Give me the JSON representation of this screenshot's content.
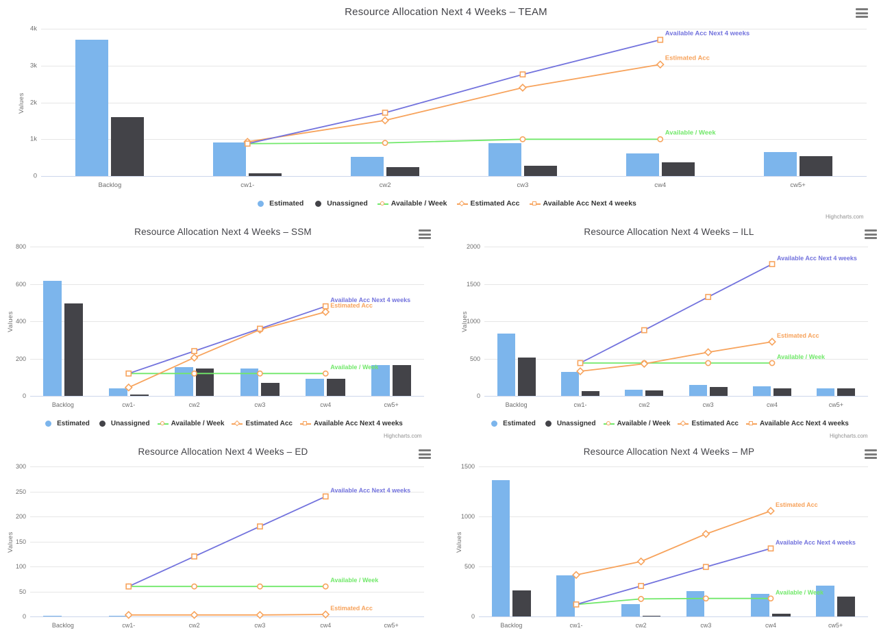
{
  "colors": {
    "estimated": "#7cb5ec",
    "unassigned": "#434348",
    "available_week": "#71e86a",
    "estimated_acc": "#f7a35c",
    "available_acc": "#7272dd",
    "marker_outline": "#f7a35c",
    "gridline": "#e6e6e6",
    "axis": "#ccd6eb",
    "text": "#6e6e6e"
  },
  "common": {
    "menu_icon": "hamburger-menu-icon",
    "credit": "Highcharts.com",
    "ylabel": "Values",
    "legend": [
      {
        "label": "Estimated",
        "symbol": "circle-filled",
        "color": "#7cb5ec"
      },
      {
        "label": "Unassigned",
        "symbol": "circle-filled",
        "color": "#434348"
      },
      {
        "label": "Available / Week",
        "symbol": "line-circle",
        "color": "#71e86a"
      },
      {
        "label": "Estimated Acc",
        "symbol": "line-diamond",
        "color": "#f7a35c"
      },
      {
        "label": "Available Acc Next 4 weeks",
        "symbol": "line-square",
        "color": "#f7a35c"
      }
    ]
  },
  "chart_data": [
    {
      "id": "team",
      "type": "bar",
      "title": "Resource Allocation Next 4 Weeks – TEAM",
      "xlabel": "",
      "ylabel": "Values",
      "categories": [
        "Backlog",
        "cw1-",
        "cw2",
        "cw3",
        "cw4",
        "cw5+"
      ],
      "ylim": [
        0,
        4000
      ],
      "yticks": [
        0,
        1000,
        2000,
        3000,
        4000
      ],
      "yticklabels": [
        "0",
        "1k",
        "2k",
        "3k",
        "4k"
      ],
      "grid": true,
      "legend_position": "bottom",
      "series": [
        {
          "name": "Estimated",
          "type": "column",
          "color": "#7cb5ec",
          "values": [
            3700,
            920,
            520,
            900,
            620,
            660
          ]
        },
        {
          "name": "Unassigned",
          "type": "column",
          "color": "#434348",
          "values": [
            1600,
            80,
            240,
            280,
            370,
            540
          ]
        },
        {
          "name": "Available / Week",
          "type": "line",
          "color": "#71e86a",
          "values": [
            null,
            880,
            900,
            1000,
            1000,
            null
          ],
          "label": "Available / Week",
          "label_at": 4
        },
        {
          "name": "Estimated Acc",
          "type": "line",
          "color": "#f7a35c",
          "values": [
            null,
            930,
            1510,
            2400,
            3030,
            null
          ],
          "label": "Estimated Acc",
          "label_at": 4
        },
        {
          "name": "Available Acc Next 4 weeks",
          "type": "line",
          "color": "#7272dd",
          "values": [
            null,
            880,
            1720,
            2760,
            3700,
            null
          ],
          "label": "Available Acc Next 4 weeks",
          "label_at": 4
        }
      ]
    },
    {
      "id": "ssm",
      "type": "bar",
      "title": "Resource Allocation Next 4 Weeks – SSM",
      "xlabel": "",
      "ylabel": "Values",
      "categories": [
        "Backlog",
        "cw1-",
        "cw2",
        "cw3",
        "cw4",
        "cw5+"
      ],
      "ylim": [
        0,
        800
      ],
      "yticks": [
        0,
        200,
        400,
        600,
        800
      ],
      "yticklabels": [
        "0",
        "200",
        "400",
        "600",
        "800"
      ],
      "grid": true,
      "legend_position": "bottom",
      "series": [
        {
          "name": "Estimated",
          "type": "column",
          "color": "#7cb5ec",
          "values": [
            615,
            42,
            153,
            148,
            90,
            165
          ]
        },
        {
          "name": "Unassigned",
          "type": "column",
          "color": "#434348",
          "values": [
            495,
            8,
            148,
            68,
            90,
            165
          ]
        },
        {
          "name": "Available / Week",
          "type": "line",
          "color": "#71e86a",
          "values": [
            null,
            120,
            120,
            120,
            120,
            null
          ],
          "label": "Available / Week",
          "label_at": 4
        },
        {
          "name": "Estimated Acc",
          "type": "line",
          "color": "#f7a35c",
          "values": [
            null,
            45,
            205,
            355,
            450,
            null
          ],
          "label": "Estimated Acc",
          "label_at": 4
        },
        {
          "name": "Available Acc Next 4 weeks",
          "type": "line",
          "color": "#7272dd",
          "values": [
            null,
            120,
            240,
            360,
            480,
            null
          ],
          "label": "Available Acc Next 4 weeks",
          "label_at": 4
        }
      ]
    },
    {
      "id": "ill",
      "type": "bar",
      "title": "Resource Allocation Next 4 Weeks – ILL",
      "xlabel": "",
      "ylabel": "Values",
      "categories": [
        "Backlog",
        "cw1-",
        "cw2",
        "cw3",
        "cw4",
        "cw5+"
      ],
      "ylim": [
        0,
        2000
      ],
      "yticks": [
        0,
        500,
        1000,
        1500,
        2000
      ],
      "yticklabels": [
        "0",
        "500",
        "1000",
        "1500",
        "2000"
      ],
      "grid": true,
      "legend_position": "bottom",
      "series": [
        {
          "name": "Estimated",
          "type": "column",
          "color": "#7cb5ec",
          "values": [
            835,
            320,
            85,
            145,
            130,
            100
          ]
        },
        {
          "name": "Unassigned",
          "type": "column",
          "color": "#434348",
          "values": [
            510,
            60,
            70,
            120,
            105,
            100
          ]
        },
        {
          "name": "Available / Week",
          "type": "line",
          "color": "#71e86a",
          "values": [
            null,
            440,
            440,
            440,
            440,
            null
          ],
          "label": "Available / Week",
          "label_at": 4
        },
        {
          "name": "Estimated Acc",
          "type": "line",
          "color": "#f7a35c",
          "values": [
            null,
            330,
            430,
            585,
            725,
            null
          ],
          "label": "Estimated Acc",
          "label_at": 4
        },
        {
          "name": "Available Acc Next 4 weeks",
          "type": "line",
          "color": "#7272dd",
          "values": [
            null,
            440,
            880,
            1325,
            1765,
            null
          ],
          "label": "Available Acc Next 4 weeks",
          "label_at": 4
        }
      ]
    },
    {
      "id": "ed",
      "type": "bar",
      "title": "Resource Allocation Next 4 Weeks – ED",
      "xlabel": "",
      "ylabel": "Values",
      "categories": [
        "Backlog",
        "cw1-",
        "cw2",
        "cw3",
        "cw4",
        "cw5+"
      ],
      "ylim": [
        0,
        300
      ],
      "yticks": [
        0,
        50,
        100,
        150,
        200,
        250,
        300
      ],
      "yticklabels": [
        "0",
        "50",
        "100",
        "150",
        "200",
        "250",
        "300"
      ],
      "grid": true,
      "legend_position": "none",
      "series": [
        {
          "name": "Estimated",
          "type": "column",
          "color": "#7cb5ec",
          "values": [
            2,
            2,
            0,
            0,
            0,
            0
          ]
        },
        {
          "name": "Unassigned",
          "type": "column",
          "color": "#434348",
          "values": [
            0,
            0,
            0,
            0,
            0,
            0
          ]
        },
        {
          "name": "Available / Week",
          "type": "line",
          "color": "#71e86a",
          "values": [
            null,
            60,
            60,
            60,
            60,
            null
          ],
          "label": "Available / Week",
          "label_at": 4
        },
        {
          "name": "Estimated Acc",
          "type": "line",
          "color": "#f7a35c",
          "values": [
            null,
            3,
            3,
            3,
            4,
            null
          ],
          "label": "Estimated Acc",
          "label_at": 4
        },
        {
          "name": "Available Acc Next 4 weeks",
          "type": "line",
          "color": "#7272dd",
          "values": [
            null,
            60,
            120,
            180,
            240,
            null
          ],
          "label": "Available Acc Next 4 weeks",
          "label_at": 4
        }
      ]
    },
    {
      "id": "mp",
      "type": "bar",
      "title": "Resource Allocation Next 4 Weeks – MP",
      "xlabel": "",
      "ylabel": "Values",
      "categories": [
        "Backlog",
        "cw1-",
        "cw2",
        "cw3",
        "cw4",
        "cw5+"
      ],
      "ylim": [
        0,
        1500
      ],
      "yticks": [
        0,
        500,
        1000,
        1500
      ],
      "yticklabels": [
        "0",
        "500",
        "1000",
        "1500"
      ],
      "grid": true,
      "legend_position": "none",
      "series": [
        {
          "name": "Estimated",
          "type": "column",
          "color": "#7cb5ec",
          "values": [
            1365,
            410,
            125,
            255,
            225,
            305
          ]
        },
        {
          "name": "Unassigned",
          "type": "column",
          "color": "#434348",
          "values": [
            260,
            0,
            8,
            0,
            30,
            200
          ]
        },
        {
          "name": "Available / Week",
          "type": "line",
          "color": "#71e86a",
          "values": [
            null,
            120,
            175,
            180,
            180,
            null
          ],
          "label": "Available / Week",
          "label_at": 4
        },
        {
          "name": "Estimated Acc",
          "type": "line",
          "color": "#f7a35c",
          "values": [
            null,
            415,
            550,
            825,
            1055,
            null
          ],
          "label": "Estimated Acc",
          "label_at": 4
        },
        {
          "name": "Available Acc Next 4 weeks",
          "type": "line",
          "color": "#7272dd",
          "values": [
            null,
            120,
            305,
            495,
            680,
            null
          ],
          "label": "Available Acc Next 4 weeks",
          "label_at": 4
        }
      ]
    }
  ]
}
